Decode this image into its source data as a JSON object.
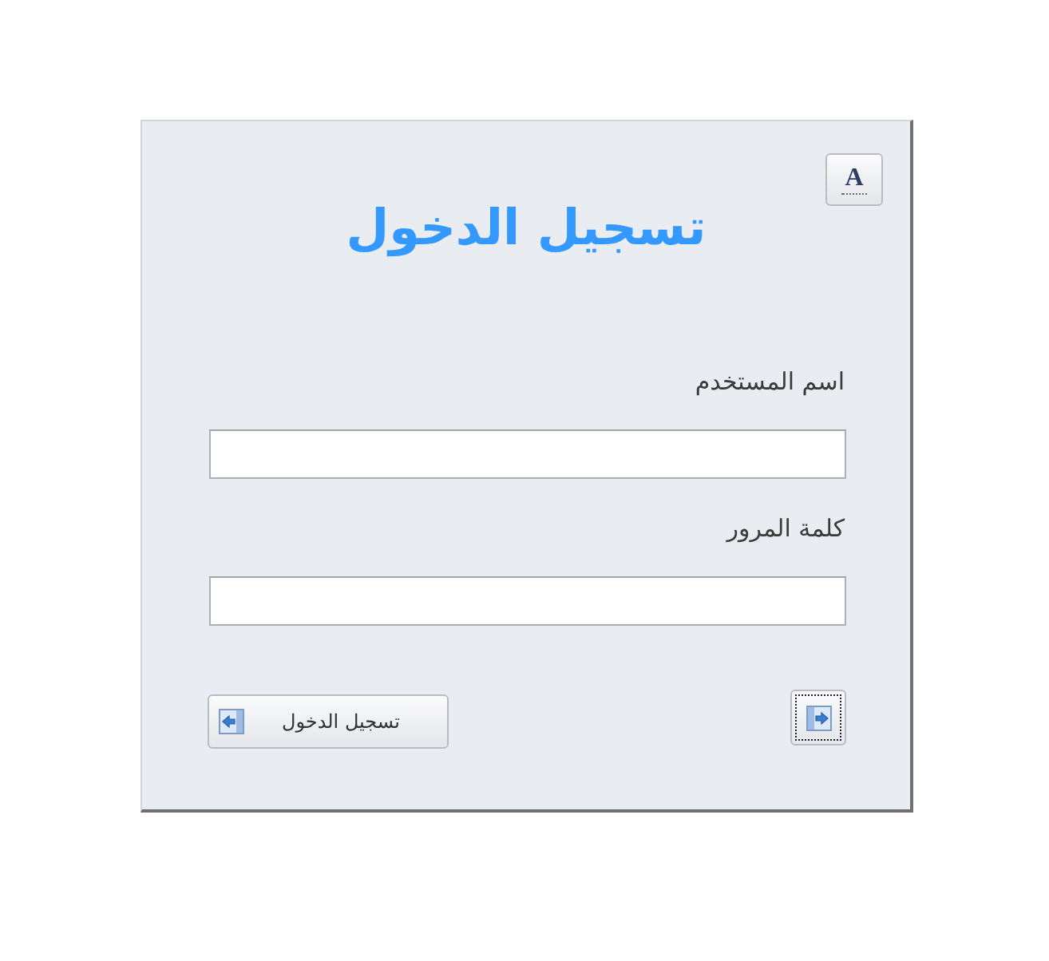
{
  "font_button": {
    "label": "A"
  },
  "heading": "تسجيل الدخول",
  "fields": [
    {
      "label": "اسم المستخدم"
    },
    {
      "label": "كلمة المرور"
    }
  ],
  "buttons": [
    {
      "kind": "login",
      "label": "تسجيل الدخول",
      "focused": false
    },
    {
      "kind": "exit",
      "focused": true
    }
  ]
}
